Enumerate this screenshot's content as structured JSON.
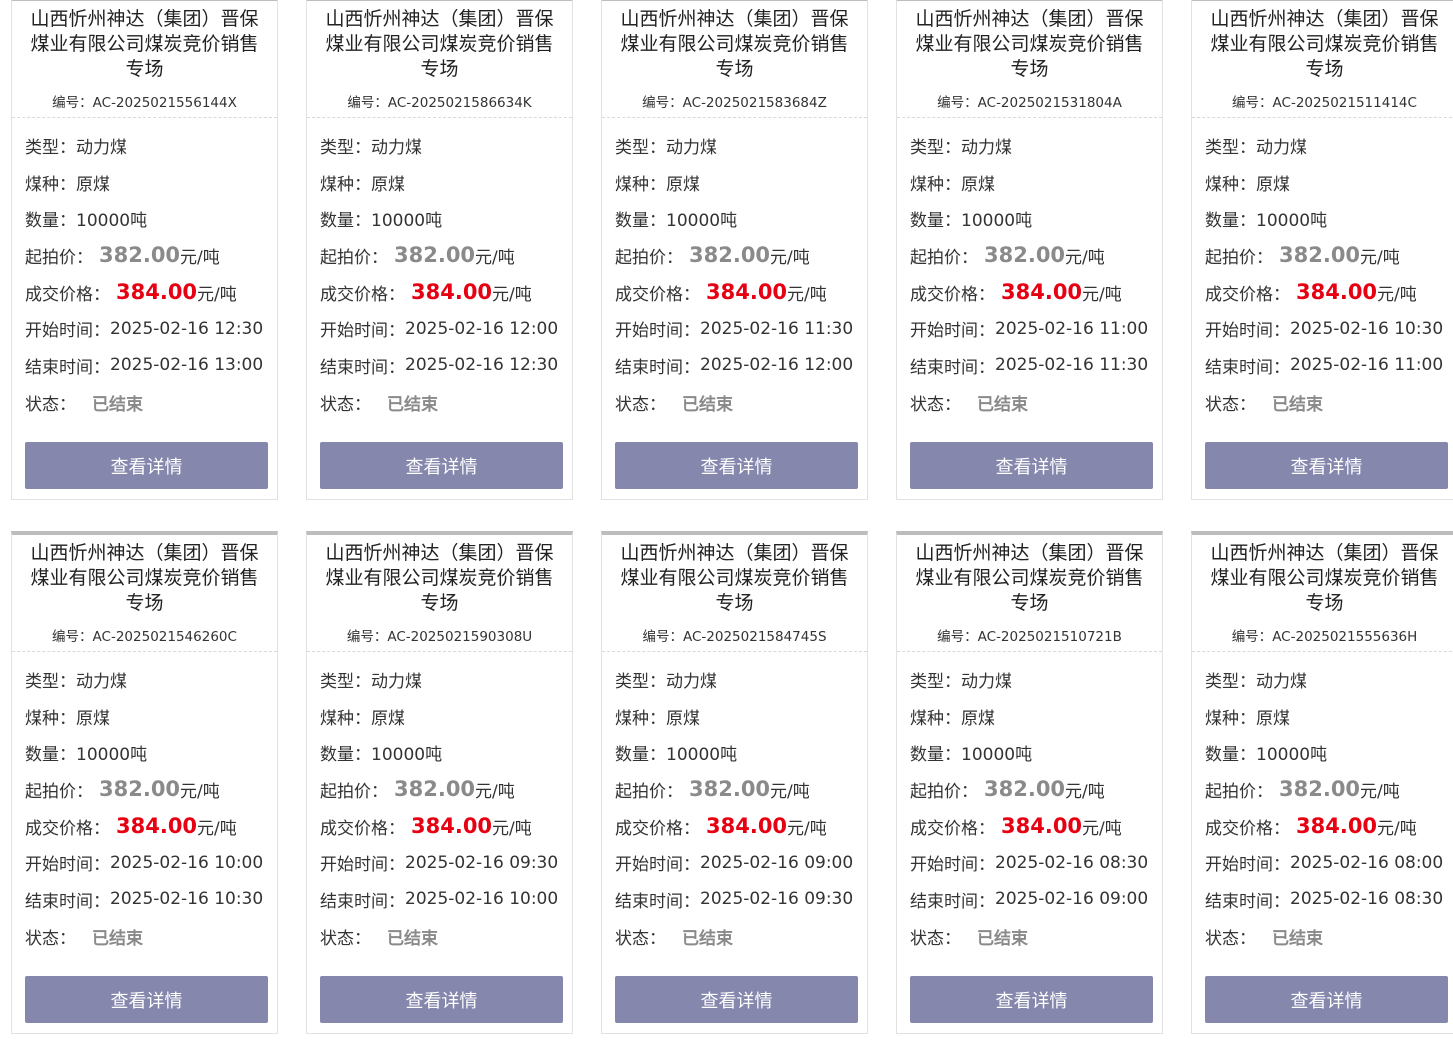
{
  "labels": {
    "code_prefix": "编号：",
    "type": "类型：",
    "variety": "煤种：",
    "quantity": "数量：",
    "start_price": "起拍价：",
    "deal_price": "成交价格：",
    "start_time": "开始时间：",
    "end_time": "结束时间：",
    "status": "状态：",
    "unit_price": "元/吨",
    "detail_button": "查看详情"
  },
  "cards": [
    {
      "title": "山西忻州神达（集团）晋保煤业有限公司煤炭竞价销售专场",
      "code": "AC-2025021556144X",
      "type": "动力煤",
      "variety": "原煤",
      "quantity": "10000吨",
      "start_price": "382.00",
      "deal_price": "384.00",
      "start_time": "2025-02-16 12:30",
      "end_time": "2025-02-16 13:00",
      "status": "已结束"
    },
    {
      "title": "山西忻州神达（集团）晋保煤业有限公司煤炭竞价销售专场",
      "code": "AC-2025021586634K",
      "type": "动力煤",
      "variety": "原煤",
      "quantity": "10000吨",
      "start_price": "382.00",
      "deal_price": "384.00",
      "start_time": "2025-02-16 12:00",
      "end_time": "2025-02-16 12:30",
      "status": "已结束"
    },
    {
      "title": "山西忻州神达（集团）晋保煤业有限公司煤炭竞价销售专场",
      "code": "AC-2025021583684Z",
      "type": "动力煤",
      "variety": "原煤",
      "quantity": "10000吨",
      "start_price": "382.00",
      "deal_price": "384.00",
      "start_time": "2025-02-16 11:30",
      "end_time": "2025-02-16 12:00",
      "status": "已结束"
    },
    {
      "title": "山西忻州神达（集团）晋保煤业有限公司煤炭竞价销售专场",
      "code": "AC-2025021531804A",
      "type": "动力煤",
      "variety": "原煤",
      "quantity": "10000吨",
      "start_price": "382.00",
      "deal_price": "384.00",
      "start_time": "2025-02-16 11:00",
      "end_time": "2025-02-16 11:30",
      "status": "已结束"
    },
    {
      "title": "山西忻州神达（集团）晋保煤业有限公司煤炭竞价销售专场",
      "code": "AC-2025021511414C",
      "type": "动力煤",
      "variety": "原煤",
      "quantity": "10000吨",
      "start_price": "382.00",
      "deal_price": "384.00",
      "start_time": "2025-02-16 10:30",
      "end_time": "2025-02-16 11:00",
      "status": "已结束"
    },
    {
      "title": "山西忻州神达（集团）晋保煤业有限公司煤炭竞价销售专场",
      "code": "AC-2025021546260C",
      "type": "动力煤",
      "variety": "原煤",
      "quantity": "10000吨",
      "start_price": "382.00",
      "deal_price": "384.00",
      "start_time": "2025-02-16 10:00",
      "end_time": "2025-02-16 10:30",
      "status": "已结束"
    },
    {
      "title": "山西忻州神达（集团）晋保煤业有限公司煤炭竞价销售专场",
      "code": "AC-2025021590308U",
      "type": "动力煤",
      "variety": "原煤",
      "quantity": "10000吨",
      "start_price": "382.00",
      "deal_price": "384.00",
      "start_time": "2025-02-16 09:30",
      "end_time": "2025-02-16 10:00",
      "status": "已结束"
    },
    {
      "title": "山西忻州神达（集团）晋保煤业有限公司煤炭竞价销售专场",
      "code": "AC-2025021584745S",
      "type": "动力煤",
      "variety": "原煤",
      "quantity": "10000吨",
      "start_price": "382.00",
      "deal_price": "384.00",
      "start_time": "2025-02-16 09:00",
      "end_time": "2025-02-16 09:30",
      "status": "已结束"
    },
    {
      "title": "山西忻州神达（集团）晋保煤业有限公司煤炭竞价销售专场",
      "code": "AC-2025021510721B",
      "type": "动力煤",
      "variety": "原煤",
      "quantity": "10000吨",
      "start_price": "382.00",
      "deal_price": "384.00",
      "start_time": "2025-02-16 08:30",
      "end_time": "2025-02-16 09:00",
      "status": "已结束"
    },
    {
      "title": "山西忻州神达（集团）晋保煤业有限公司煤炭竞价销售专场",
      "code": "AC-2025021555636H",
      "type": "动力煤",
      "variety": "原煤",
      "quantity": "10000吨",
      "start_price": "382.00",
      "deal_price": "384.00",
      "start_time": "2025-02-16 08:00",
      "end_time": "2025-02-16 08:30",
      "status": "已结束"
    }
  ]
}
